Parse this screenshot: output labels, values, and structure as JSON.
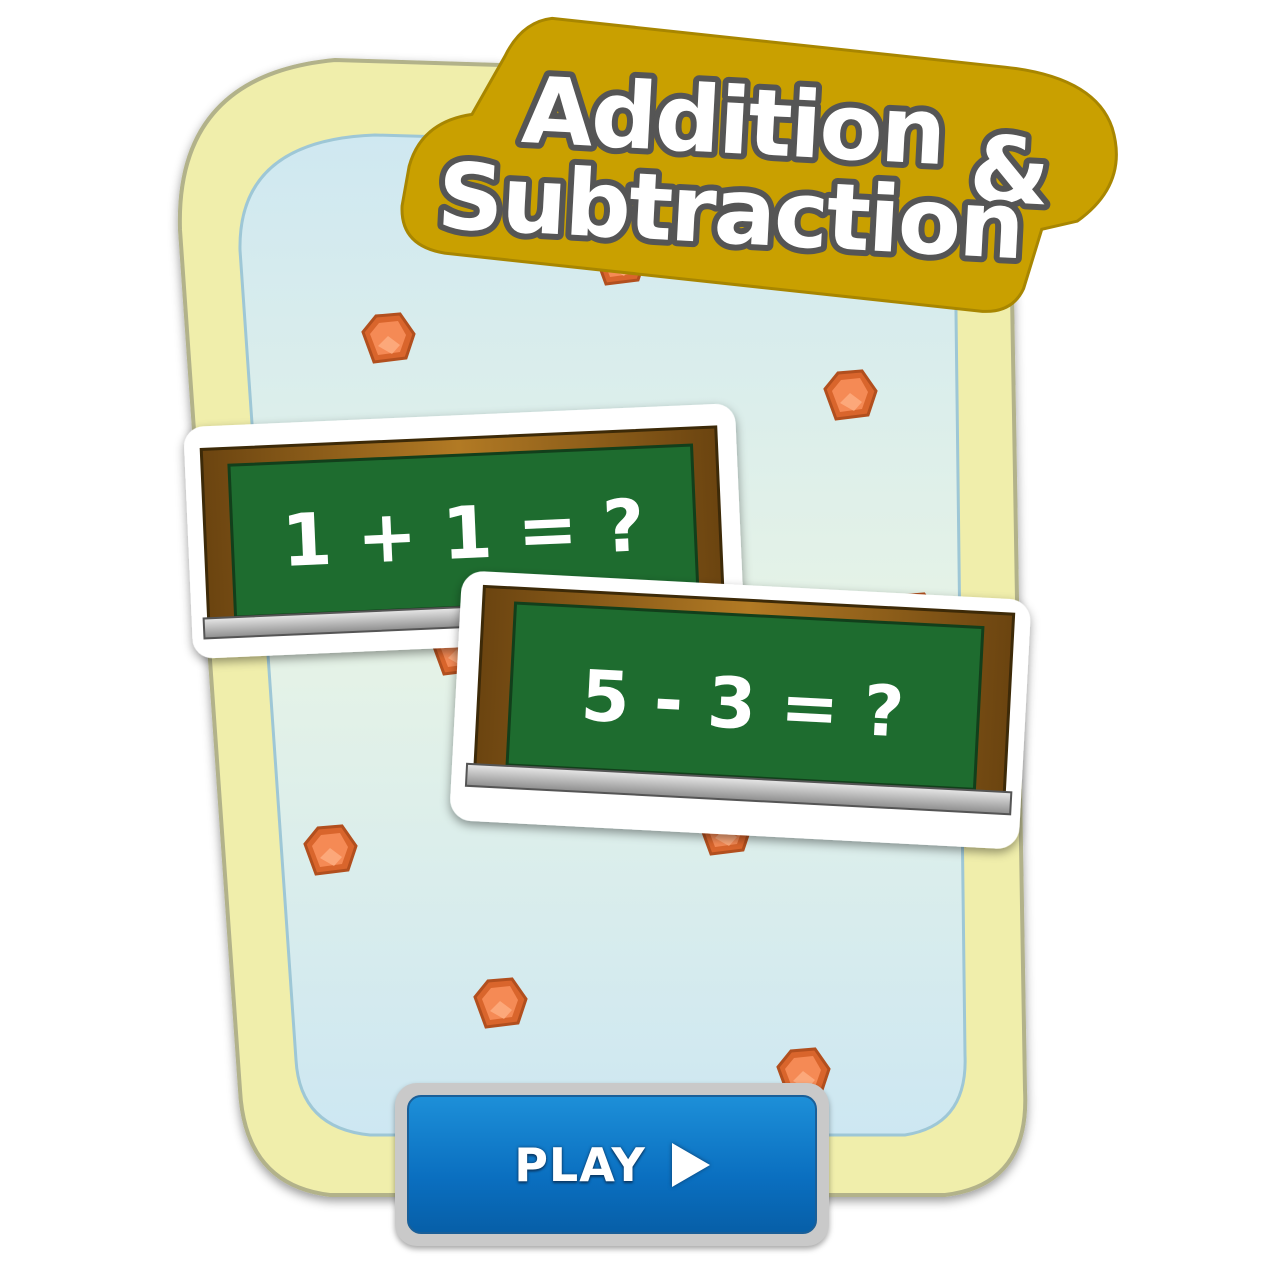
{
  "title": {
    "line1": "Addition",
    "ampersand": "&",
    "line2": "Subtraction"
  },
  "boards": [
    {
      "equation": "1 + 1 = ?"
    },
    {
      "equation": "5 - 3 = ?"
    }
  ],
  "play_button": {
    "label": "PLAY",
    "icon": "play-arrow-icon"
  },
  "colors": {
    "frame": "#f0ecaa",
    "panel": "#d7edf2",
    "chalkboard": "#1d6b2e",
    "wood": "#8a5a14",
    "title_outline": "#c9a000",
    "gem": "#f07a4a",
    "button": "#0b73c4"
  },
  "decorations": {
    "gem_count": 9,
    "gem_icon": "orange-gem-icon"
  }
}
